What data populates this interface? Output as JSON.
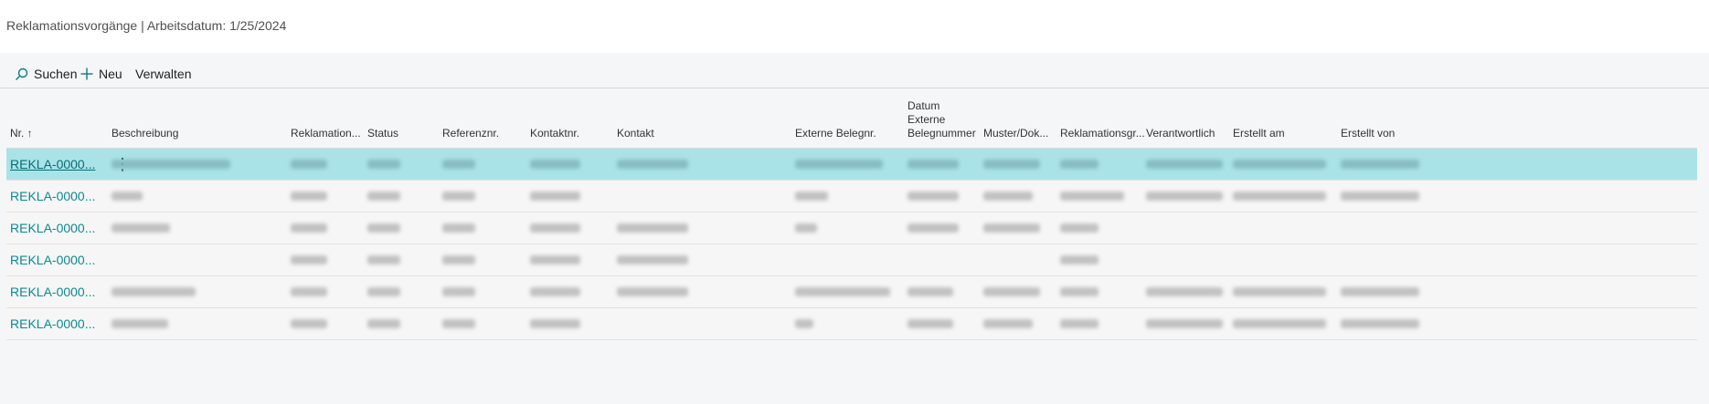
{
  "title": "Reklamationsvorgänge | Arbeitsdatum: 1/25/2024",
  "actions": {
    "search": "Suchen",
    "new": "Neu",
    "manage": "Verwalten"
  },
  "columns": {
    "nr": "Nr. ↑",
    "beschreibung": "Beschreibung",
    "reklamation": "Reklamation...",
    "status": "Status",
    "referenz": "Referenznr.",
    "kontaktnr": "Kontaktnr.",
    "kontakt": "Kontakt",
    "externe_belegnr": "Externe Belegnr.",
    "datum_l1": "Datum",
    "datum_l2": "Externe",
    "datum_l3": "Belegnummer",
    "muster": "Muster/Dok...",
    "reklamationsgr": "Reklamationsgr...",
    "verantwortlich": "Verantwortlich",
    "erstellt_am": "Erstellt am",
    "erstellt_von": "Erstellt von"
  },
  "rows": [
    {
      "nr": "REKLA-0000..."
    },
    {
      "nr": "REKLA-0000..."
    },
    {
      "nr": "REKLA-0000..."
    },
    {
      "nr": "REKLA-0000..."
    },
    {
      "nr": "REKLA-0000..."
    },
    {
      "nr": "REKLA-0000..."
    }
  ],
  "row_menu": "⋮",
  "colors": {
    "selected_row": "#a9e3e8",
    "link": "#0b8a8f"
  },
  "icons": {
    "search": "search-icon",
    "new": "plus-icon"
  }
}
